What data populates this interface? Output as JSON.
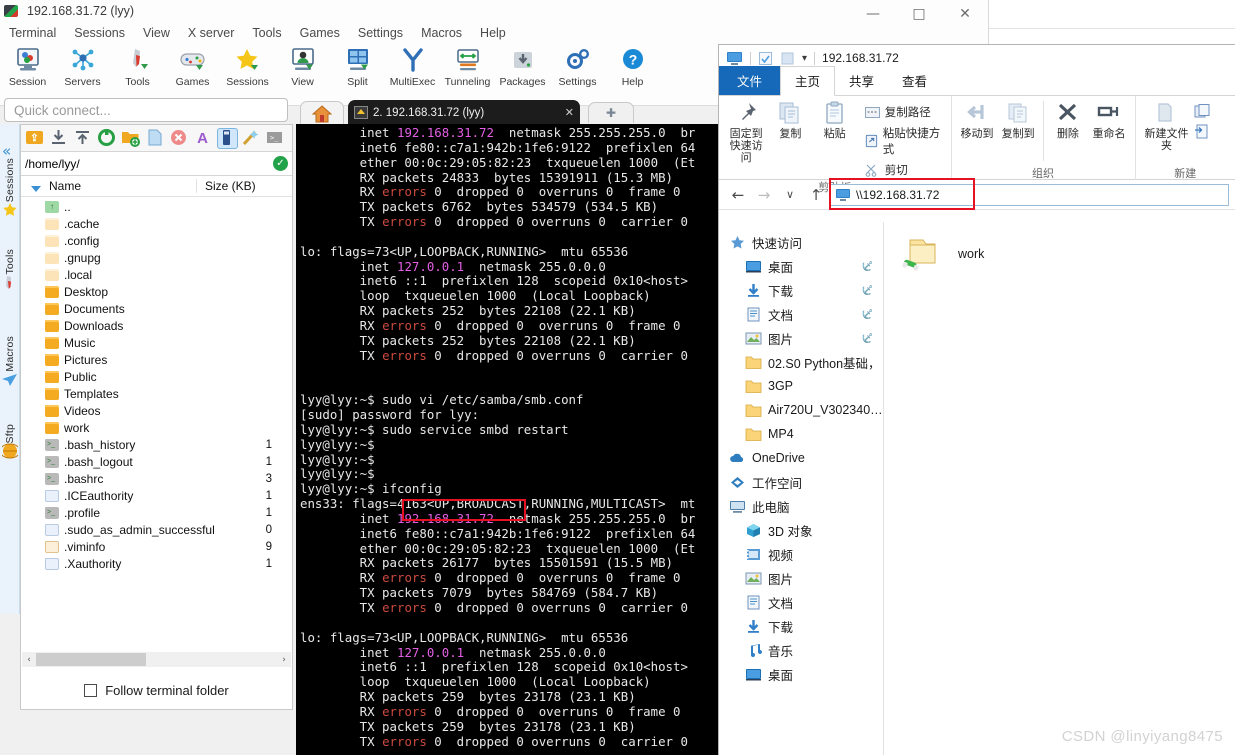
{
  "moba": {
    "title": "192.168.31.72 (lyy)",
    "window_buttons": {
      "minimize": "—",
      "maximize": "□",
      "close": "✕"
    },
    "menu": [
      "Terminal",
      "Sessions",
      "View",
      "X server",
      "Tools",
      "Games",
      "Settings",
      "Macros",
      "Help"
    ],
    "toolbar": [
      {
        "label": "Session",
        "icon": "session-icon"
      },
      {
        "label": "Servers",
        "icon": "servers-icon"
      },
      {
        "label": "Tools",
        "icon": "tools-icon"
      },
      {
        "label": "Games",
        "icon": "games-icon"
      },
      {
        "label": "Sessions",
        "icon": "sessions-star-icon"
      },
      {
        "label": "View",
        "icon": "view-icon"
      },
      {
        "label": "Split",
        "icon": "split-icon"
      },
      {
        "label": "MultiExec",
        "icon": "multiexec-icon"
      },
      {
        "label": "Tunneling",
        "icon": "tunneling-icon"
      },
      {
        "label": "Packages",
        "icon": "packages-icon"
      },
      {
        "label": "Settings",
        "icon": "settings-gear-icon"
      },
      {
        "label": "Help",
        "icon": "help-question-icon"
      }
    ],
    "quick_connect_placeholder": "Quick connect...",
    "tabs": {
      "home_icon": "home-icon",
      "active_tab": "2. 192.168.31.72 (lyy)",
      "close_label": "✕",
      "new_tab_label": "✚"
    },
    "side_tabs": [
      "Sessions",
      "Tools",
      "Macros",
      "Sftp"
    ],
    "sftp": {
      "path": "/home/lyy/",
      "path_ok_icon": "check-circle-icon",
      "columns": [
        "Name",
        "Size (KB)"
      ],
      "rows": [
        {
          "name": "..",
          "size": "",
          "kind": "up"
        },
        {
          "name": ".cache",
          "size": "",
          "kind": "folderlt"
        },
        {
          "name": ".config",
          "size": "",
          "kind": "folderlt"
        },
        {
          "name": ".gnupg",
          "size": "",
          "kind": "folderlt"
        },
        {
          "name": ".local",
          "size": "",
          "kind": "folderlt"
        },
        {
          "name": "Desktop",
          "size": "",
          "kind": "folder"
        },
        {
          "name": "Documents",
          "size": "",
          "kind": "folder"
        },
        {
          "name": "Downloads",
          "size": "",
          "kind": "folder"
        },
        {
          "name": "Music",
          "size": "",
          "kind": "folder"
        },
        {
          "name": "Pictures",
          "size": "",
          "kind": "folder"
        },
        {
          "name": "Public",
          "size": "",
          "kind": "folder"
        },
        {
          "name": "Templates",
          "size": "",
          "kind": "folder"
        },
        {
          "name": "Videos",
          "size": "",
          "kind": "folder"
        },
        {
          "name": "work",
          "size": "",
          "kind": "folder"
        },
        {
          "name": ".bash_history",
          "size": "1",
          "kind": "sh"
        },
        {
          "name": ".bash_logout",
          "size": "1",
          "kind": "sh"
        },
        {
          "name": ".bashrc",
          "size": "3",
          "kind": "sh"
        },
        {
          "name": ".ICEauthority",
          "size": "1",
          "kind": "doc"
        },
        {
          "name": ".profile",
          "size": "1",
          "kind": "sh"
        },
        {
          "name": ".sudo_as_admin_successful",
          "size": "0",
          "kind": "doc"
        },
        {
          "name": ".viminfo",
          "size": "9",
          "kind": "vim"
        },
        {
          "name": ".Xauthority",
          "size": "1",
          "kind": "doc"
        }
      ],
      "follow_label": "Follow terminal folder",
      "scroll_left": "‹",
      "scroll_right": "›"
    },
    "terminal": {
      "highlight_color": "#e81123",
      "lines": [
        [
          [
            "        inet ",
            "w"
          ],
          [
            "192.168.31.72",
            "m"
          ],
          [
            "  netmask 255.255.255.0  br",
            "w"
          ]
        ],
        [
          [
            "        inet6 fe80::c7a1:942b:1fe6:9122  prefixlen 64",
            "w"
          ]
        ],
        [
          [
            "        ether 00:0c:29:05:82:23  txqueuelen 1000  (Et",
            "w"
          ]
        ],
        [
          [
            "        RX packets 24833  bytes 15391911 (15.3 MB)",
            "w"
          ]
        ],
        [
          [
            "        RX ",
            "w"
          ],
          [
            "errors",
            "r"
          ],
          [
            " 0  dropped 0  overruns 0  frame 0",
            "w"
          ]
        ],
        [
          [
            "        TX packets 6762  bytes 534579 (534.5 KB)",
            "w"
          ]
        ],
        [
          [
            "        TX ",
            "w"
          ],
          [
            "errors",
            "r"
          ],
          [
            " 0  dropped 0 overruns 0  carrier 0",
            "w"
          ]
        ],
        [
          [
            "",
            "w"
          ]
        ],
        [
          [
            "lo: flags=73<UP,LOOPBACK,RUNNING>  mtu 65536",
            "w"
          ]
        ],
        [
          [
            "        inet ",
            "w"
          ],
          [
            "127.0.0.1",
            "m"
          ],
          [
            "  netmask 255.0.0.0",
            "w"
          ]
        ],
        [
          [
            "        inet6 ::1  prefixlen 128  scopeid 0x10<host>",
            "w"
          ]
        ],
        [
          [
            "        loop  txqueuelen 1000  (Local Loopback)",
            "w"
          ]
        ],
        [
          [
            "        RX packets 252  bytes 22108 (22.1 KB)",
            "w"
          ]
        ],
        [
          [
            "        RX ",
            "w"
          ],
          [
            "errors",
            "r"
          ],
          [
            " 0  dropped 0  overruns 0  frame 0",
            "w"
          ]
        ],
        [
          [
            "        TX packets 252  bytes 22108 (22.1 KB)",
            "w"
          ]
        ],
        [
          [
            "        TX ",
            "w"
          ],
          [
            "errors",
            "r"
          ],
          [
            " 0  dropped 0 overruns 0  carrier 0",
            "w"
          ]
        ],
        [
          [
            "",
            "w"
          ]
        ],
        [
          [
            "",
            "w"
          ]
        ],
        [
          [
            "lyy@lyy:~$ sudo vi /etc/samba/smb.conf",
            "w"
          ]
        ],
        [
          [
            "[sudo] password for lyy:",
            "w"
          ]
        ],
        [
          [
            "lyy@lyy:~$ sudo service smbd restart",
            "w"
          ]
        ],
        [
          [
            "lyy@lyy:~$",
            "w"
          ]
        ],
        [
          [
            "lyy@lyy:~$",
            "w"
          ]
        ],
        [
          [
            "lyy@lyy:~$",
            "w"
          ]
        ],
        [
          [
            "lyy@lyy:~$ ifconfig",
            "w"
          ]
        ],
        [
          [
            "ens33: flags=4163<UP,BROADCAST,RUNNING,MULTICAST>  mt",
            "w"
          ]
        ],
        [
          [
            "        inet ",
            "w"
          ],
          [
            "192.168.31.72",
            "m"
          ],
          [
            "  netmask 255.255.255.0  br",
            "w"
          ]
        ],
        [
          [
            "        inet6 fe80::c7a1:942b:1fe6:9122  prefixlen 64",
            "w"
          ]
        ],
        [
          [
            "        ether 00:0c:29:05:82:23  txqueuelen 1000  (Et",
            "w"
          ]
        ],
        [
          [
            "        RX packets 26177  bytes 15501591 (15.5 MB)",
            "w"
          ]
        ],
        [
          [
            "        RX ",
            "w"
          ],
          [
            "errors",
            "r"
          ],
          [
            " 0  dropped 0  overruns 0  frame 0",
            "w"
          ]
        ],
        [
          [
            "        TX packets 7079  bytes 584769 (584.7 KB)",
            "w"
          ]
        ],
        [
          [
            "        TX ",
            "w"
          ],
          [
            "errors",
            "r"
          ],
          [
            " 0  dropped 0 overruns 0  carrier 0",
            "w"
          ]
        ],
        [
          [
            "",
            "w"
          ]
        ],
        [
          [
            "lo: flags=73<UP,LOOPBACK,RUNNING>  mtu 65536",
            "w"
          ]
        ],
        [
          [
            "        inet ",
            "w"
          ],
          [
            "127.0.0.1",
            "m"
          ],
          [
            "  netmask 255.0.0.0",
            "w"
          ]
        ],
        [
          [
            "        inet6 ::1  prefixlen 128  scopeid 0x10<host>",
            "w"
          ]
        ],
        [
          [
            "        loop  txqueuelen 1000  (Local Loopback)",
            "w"
          ]
        ],
        [
          [
            "        RX packets 259  bytes 23178 (23.1 KB)",
            "w"
          ]
        ],
        [
          [
            "        RX ",
            "w"
          ],
          [
            "errors",
            "r"
          ],
          [
            " 0  dropped 0  overruns 0  frame 0",
            "w"
          ]
        ],
        [
          [
            "        TX packets 259  bytes 23178 (23.1 KB)",
            "w"
          ]
        ],
        [
          [
            "        TX ",
            "w"
          ],
          [
            "errors",
            "r"
          ],
          [
            " 0  dropped 0 overruns 0  carrier 0",
            "w"
          ]
        ]
      ]
    }
  },
  "explorer": {
    "quick_access_title": "192.168.31.72",
    "qat_icons": [
      "computer-icon",
      "properties-icon",
      "new-folder-icon",
      "chevron-down-icon"
    ],
    "ribbon_tabs": [
      {
        "label": "文件",
        "state": "file"
      },
      {
        "label": "主页",
        "state": "active"
      },
      {
        "label": "共享",
        "state": "normal"
      },
      {
        "label": "查看",
        "state": "normal"
      }
    ],
    "ribbon_groups": [
      {
        "name": "剪贴板",
        "big": [
          {
            "label": "固定到快速访问",
            "icon": "pin-icon"
          },
          {
            "label": "复制",
            "icon": "copy-icon"
          },
          {
            "label": "粘贴",
            "icon": "paste-icon"
          }
        ],
        "small": [
          {
            "label": "复制路径",
            "icon": "copy-path-icon"
          },
          {
            "label": "粘贴快捷方式",
            "icon": "paste-shortcut-icon"
          },
          {
            "label": "剪切",
            "icon": "cut-scissors-icon"
          }
        ]
      },
      {
        "name": "组织",
        "big": [
          {
            "label": "移动到",
            "icon": "move-to-icon"
          },
          {
            "label": "复制到",
            "icon": "copy-to-icon"
          },
          {
            "label": "删除",
            "icon": "delete-x-icon"
          },
          {
            "label": "重命名",
            "icon": "rename-icon"
          }
        ],
        "small": []
      },
      {
        "name": "新建",
        "big": [
          {
            "label": "新建文件夹",
            "icon": "new-folder-icon"
          }
        ],
        "small": [
          {
            "label": "",
            "icon": "new-item-icon"
          },
          {
            "label": "",
            "icon": "easy-access-icon"
          }
        ]
      }
    ],
    "address": {
      "back": "←",
      "forward": "→",
      "history": "∨",
      "up": "↑",
      "icon": "computer-icon",
      "value": "\\\\192.168.31.72",
      "highlight_color": "#e81123"
    },
    "nav_items": [
      {
        "label": "快速访问",
        "icon": "quick-access-star-icon",
        "indent": 0,
        "pin": ""
      },
      {
        "label": "桌面",
        "icon": "desktop-icon",
        "indent": 1,
        "pin": "📌"
      },
      {
        "label": "下载",
        "icon": "downloads-icon",
        "indent": 1,
        "pin": "📌"
      },
      {
        "label": "文档",
        "icon": "documents-icon",
        "indent": 1,
        "pin": "📌"
      },
      {
        "label": "图片",
        "icon": "pictures-icon",
        "indent": 1,
        "pin": "📌"
      },
      {
        "label": "02.S0 Python基础，",
        "icon": "folder-icon",
        "indent": 1,
        "pin": ""
      },
      {
        "label": "3GP",
        "icon": "folder-icon",
        "indent": 1,
        "pin": ""
      },
      {
        "label": "Air720U_V302340…",
        "icon": "folder-icon",
        "indent": 1,
        "pin": ""
      },
      {
        "label": "MP4",
        "icon": "folder-icon",
        "indent": 1,
        "pin": ""
      },
      {
        "label": "OneDrive",
        "icon": "onedrive-cloud-icon",
        "indent": 0,
        "pin": ""
      },
      {
        "label": "工作空间",
        "icon": "workspace-icon",
        "indent": 0,
        "pin": ""
      },
      {
        "label": "此电脑",
        "icon": "this-pc-icon",
        "indent": 0,
        "pin": ""
      },
      {
        "label": "3D 对象",
        "icon": "3d-objects-icon",
        "indent": 1,
        "pin": ""
      },
      {
        "label": "视频",
        "icon": "videos-icon",
        "indent": 1,
        "pin": ""
      },
      {
        "label": "图片",
        "icon": "pictures-icon",
        "indent": 1,
        "pin": ""
      },
      {
        "label": "文档",
        "icon": "documents-icon",
        "indent": 1,
        "pin": ""
      },
      {
        "label": "下载",
        "icon": "downloads-icon",
        "indent": 1,
        "pin": ""
      },
      {
        "label": "音乐",
        "icon": "music-icon",
        "indent": 1,
        "pin": ""
      },
      {
        "label": "桌面",
        "icon": "desktop-icon",
        "indent": 1,
        "pin": ""
      }
    ],
    "content_items": [
      {
        "label": "work",
        "icon": "shared-folder-icon"
      }
    ]
  },
  "watermark": "CSDN @linyiyang8475"
}
